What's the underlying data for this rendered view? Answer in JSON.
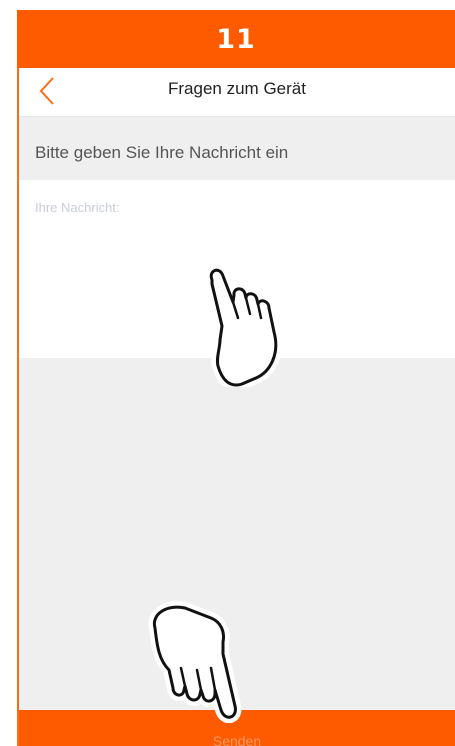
{
  "step": {
    "number": "11"
  },
  "header": {
    "title": "Fragen zum Gerät",
    "back_icon": "chevron-left-icon"
  },
  "prompt": {
    "text": "Bitte geben Sie Ihre Nachricht ein"
  },
  "message": {
    "placeholder": "Ihre Nachricht:",
    "value": ""
  },
  "footer": {
    "send_label": "Senden"
  },
  "icons": {
    "tap_hint_upper": "tap-hand-icon",
    "tap_hint_lower": "tap-hand-icon"
  },
  "colors": {
    "accent": "#fe5a00",
    "background": "#efefef",
    "placeholder": "#c9cdd6"
  }
}
